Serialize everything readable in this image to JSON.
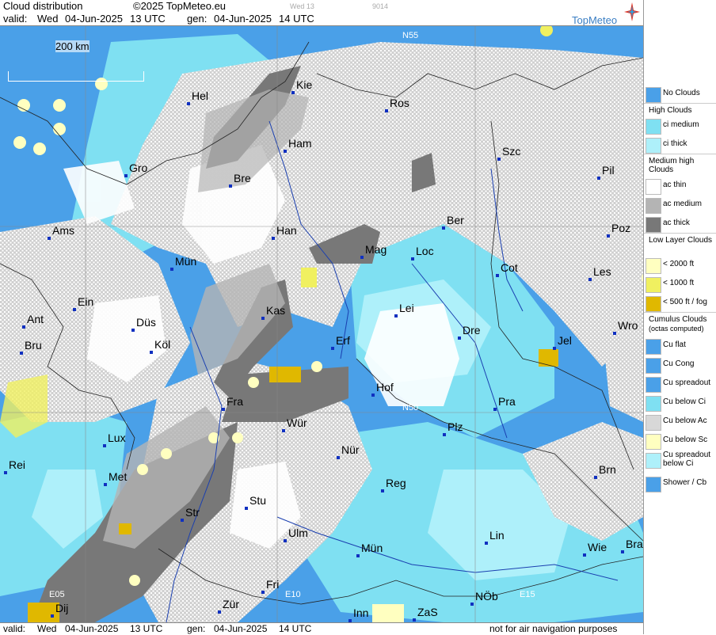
{
  "header": {
    "title": "Cloud distribution",
    "copyright": "©2025 TopMeteo.eu",
    "valid_prefix": "valid:",
    "valid_day": "Wed",
    "valid_date": "04-Jun-2025",
    "valid_time": "13 UTC",
    "gen_prefix": "gen:",
    "gen_date": "04-Jun-2025",
    "gen_time": "14 UTC",
    "faint_code_1": "Wed 13",
    "faint_code_2": "9014",
    "brand": "TopMeteo"
  },
  "footer": {
    "valid_prefix": "valid:",
    "valid_day": "Wed",
    "valid_date": "04-Jun-2025",
    "valid_time": "13 UTC",
    "gen_prefix": "gen:",
    "gen_date": "04-Jun-2025",
    "gen_time": "14 UTC",
    "disclaimer": "not for air navigation purposes"
  },
  "map": {
    "scale_label": "200 km",
    "grid_labels": [
      "N55",
      "N50",
      "E05",
      "E10",
      "E15"
    ],
    "cities": [
      "Hel",
      "Kie",
      "Ros",
      "Ham",
      "Szc",
      "Gro",
      "Bre",
      "Pil",
      "Ams",
      "Han",
      "Ber",
      "Poz",
      "Mag",
      "Loc",
      "Mün",
      "Cot",
      "Les",
      "Ein",
      "Kas",
      "Lei",
      "Ant",
      "Düs",
      "Dre",
      "Wro",
      "Erf",
      "Bru",
      "Köl",
      "Jel",
      "Hof",
      "Fra",
      "Pra",
      "Lux",
      "Wür",
      "Plz",
      "Rei",
      "Nür",
      "Met",
      "Brn",
      "Reg",
      "Stu",
      "Str",
      "Ulm",
      "Lin",
      "Wie",
      "Bra",
      "Mün",
      "Fri",
      "Dij",
      "Zür",
      "Inn",
      "ZaS",
      "NÖb"
    ]
  },
  "legend": {
    "items": [
      {
        "kind": "swatch",
        "label": "No Clouds",
        "color": "#4aa0e8"
      },
      {
        "kind": "head",
        "label": "High Clouds"
      },
      {
        "kind": "swatch",
        "label": "ci medium",
        "color": "#7fe0f2"
      },
      {
        "kind": "swatch",
        "label": "ci thick",
        "color": "#aef0fa"
      },
      {
        "kind": "head",
        "label": "Medium high Clouds"
      },
      {
        "kind": "swatch",
        "label": "ac thin",
        "color": "#ffffff"
      },
      {
        "kind": "swatch",
        "label": "ac medium",
        "color": "#b4b4b4"
      },
      {
        "kind": "swatch",
        "label": "ac thick",
        "color": "#787878"
      },
      {
        "kind": "head",
        "label": "Low Layer Clouds"
      },
      {
        "kind": "swatch",
        "label": "< 2000 ft",
        "color": "#ffffc0"
      },
      {
        "kind": "swatch",
        "label": "< 1000 ft",
        "color": "#f0f060"
      },
      {
        "kind": "swatch",
        "label": "< 500 ft / fog",
        "color": "#e0b800"
      },
      {
        "kind": "head",
        "label": "Cumulus Clouds"
      },
      {
        "kind": "subhead",
        "label": "(octas computed)"
      },
      {
        "kind": "swatch",
        "label": "Cu flat",
        "color": "#4aa0e8"
      },
      {
        "kind": "swatch",
        "label": "Cu Cong",
        "color": "#4aa0e8"
      },
      {
        "kind": "swatch",
        "label": "Cu spreadout",
        "color": "#4aa0e8"
      },
      {
        "kind": "swatch",
        "label": "Cu below Ci",
        "color": "#7fe0f2"
      },
      {
        "kind": "swatch",
        "label": "Cu below Ac",
        "color": "#d8d8d8"
      },
      {
        "kind": "swatch",
        "label": "Cu below Sc",
        "color": "#ffffc0"
      },
      {
        "kind": "swatch",
        "label": "Cu spreadout below Ci",
        "color": "#aef0fa"
      },
      {
        "kind": "swatch",
        "label": "Shower / Cb",
        "color": "#4aa0e8"
      }
    ]
  }
}
